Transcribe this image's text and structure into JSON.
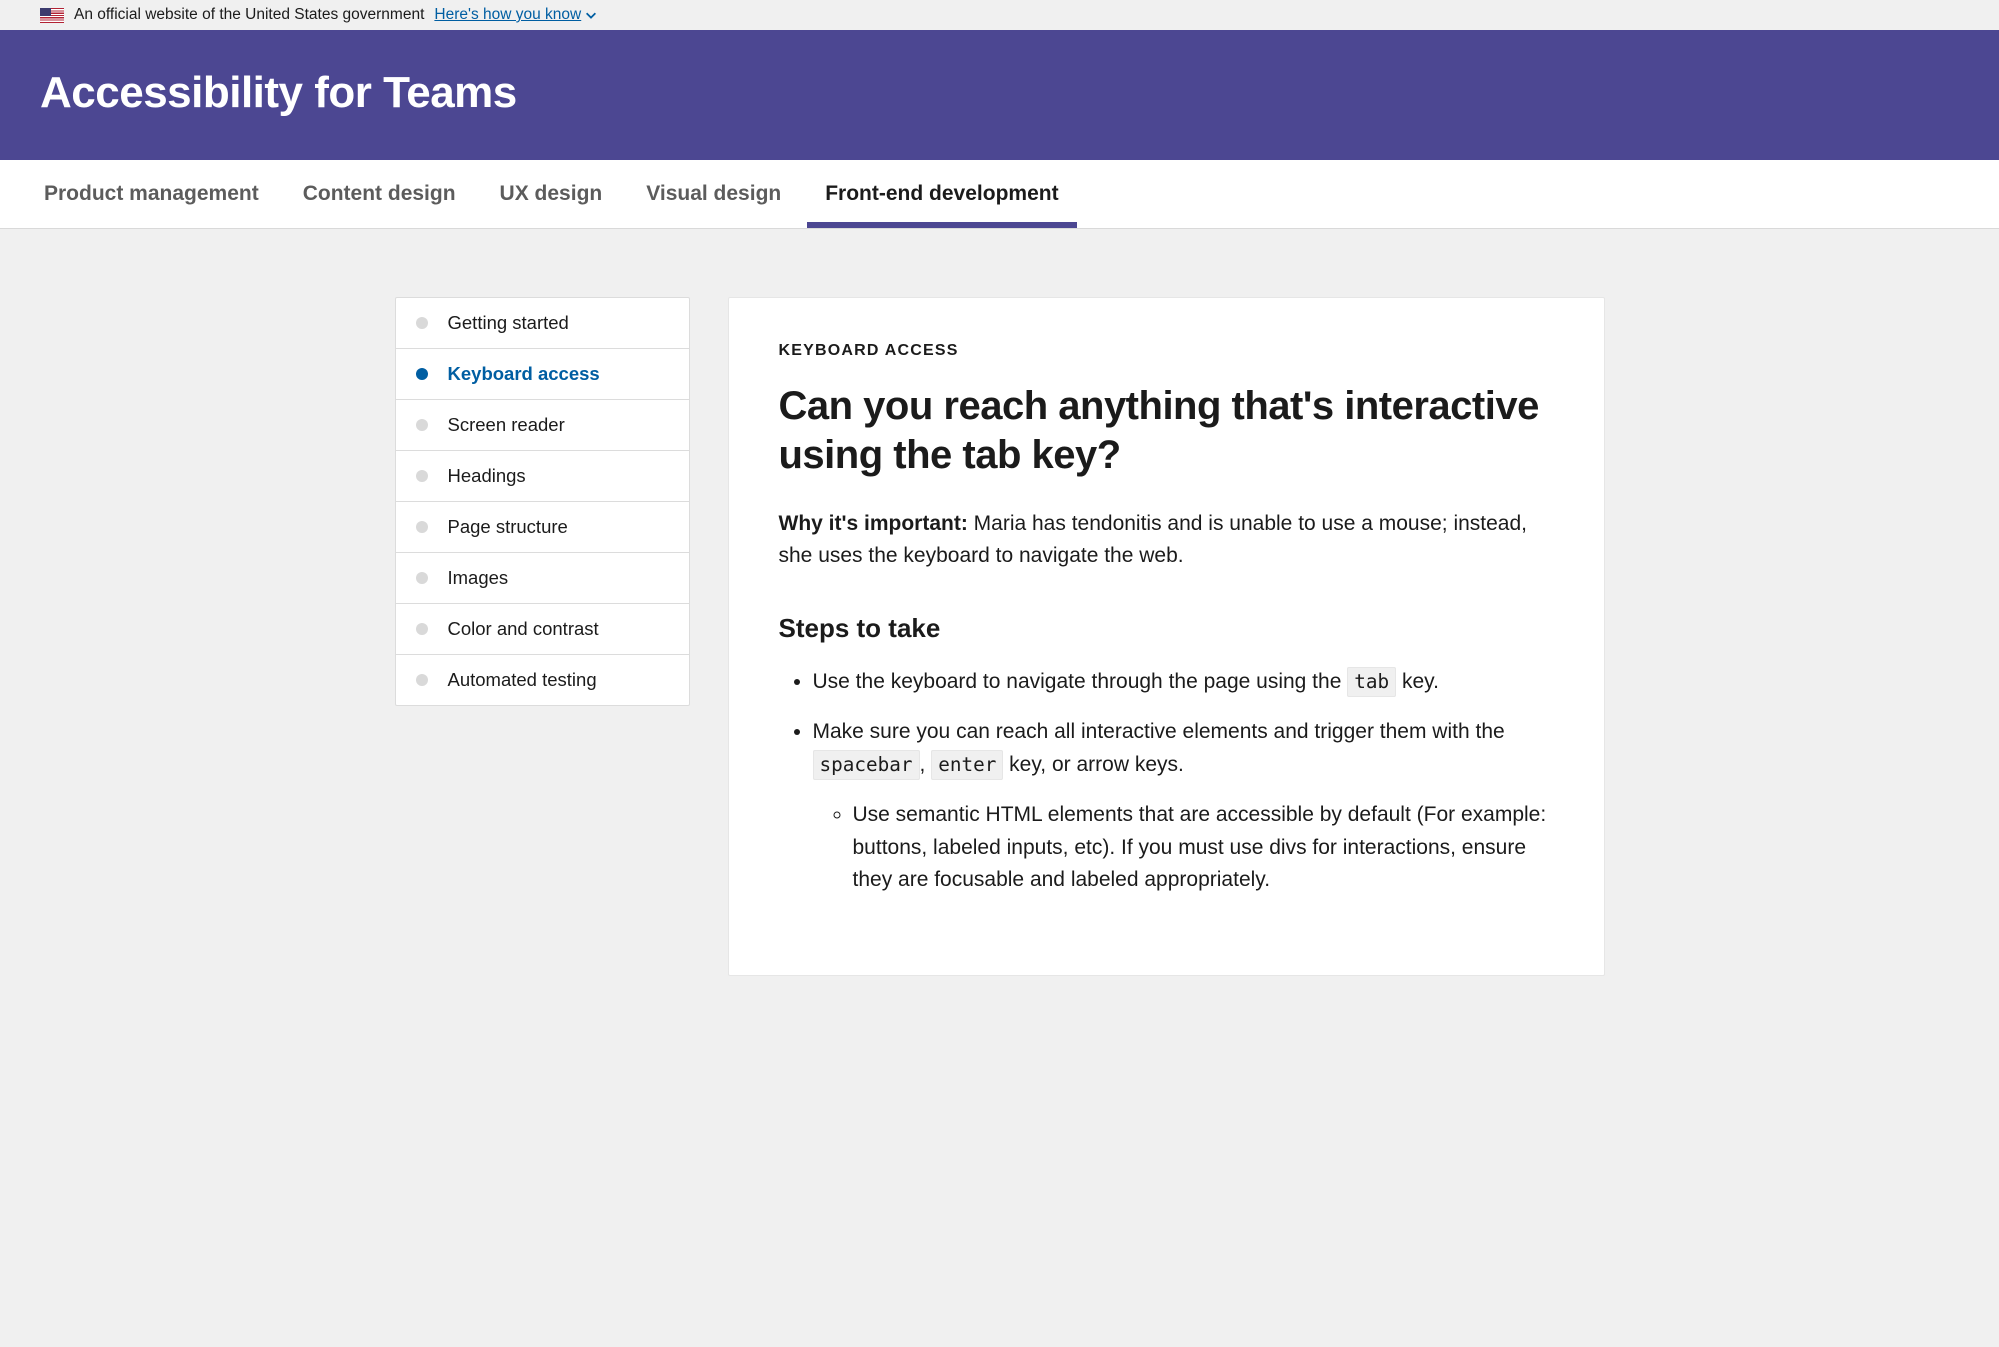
{
  "banner": {
    "text": "An official website of the United States government",
    "link": "Here's how you know"
  },
  "site_title": "Accessibility for Teams",
  "nav": [
    {
      "label": "Product management",
      "active": false
    },
    {
      "label": "Content design",
      "active": false
    },
    {
      "label": "UX design",
      "active": false
    },
    {
      "label": "Visual design",
      "active": false
    },
    {
      "label": "Front-end development",
      "active": true
    }
  ],
  "sidenav": [
    {
      "label": "Getting started",
      "current": false
    },
    {
      "label": "Keyboard access",
      "current": true
    },
    {
      "label": "Screen reader",
      "current": false
    },
    {
      "label": "Headings",
      "current": false
    },
    {
      "label": "Page structure",
      "current": false
    },
    {
      "label": "Images",
      "current": false
    },
    {
      "label": "Color and contrast",
      "current": false
    },
    {
      "label": "Automated testing",
      "current": false
    }
  ],
  "content": {
    "kicker": "KEYBOARD ACCESS",
    "title": "Can you reach anything that's interactive using the tab key?",
    "intro_label": "Why it's important:",
    "intro_body": " Maria has tendonitis and is unable to use a mouse; instead, she uses the keyboard to navigate the web.",
    "steps_heading": "Steps to take",
    "step1_a": "Use the keyboard to navigate through the page using the ",
    "step1_code": "tab",
    "step1_b": " key.",
    "step2_a": "Make sure you can reach all interactive elements and trigger them with the ",
    "step2_code1": "spacebar",
    "step2_mid": ", ",
    "step2_code2": "enter",
    "step2_b": " key, or arrow keys.",
    "step2_sub": "Use semantic HTML elements that are accessible by default (For example: buttons, labeled inputs, etc). If you must use divs for interactions, ensure they are focusable and labeled appropriately."
  }
}
